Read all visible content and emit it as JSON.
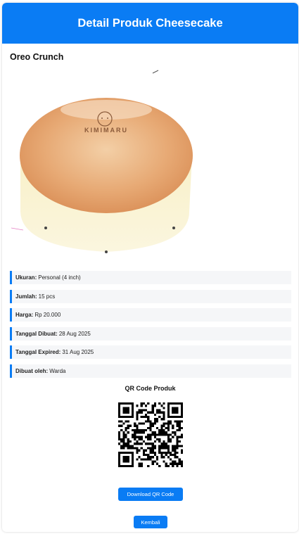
{
  "header": {
    "title": "Detail Produk Cheesecake"
  },
  "product": {
    "name": "Oreo Crunch",
    "image_icon": "cheesecake-photo",
    "image_stamp": "KIMIMARU"
  },
  "details": [
    {
      "label": "Ukuran:",
      "value": "Personal (4 inch)"
    },
    {
      "label": "Jumlah:",
      "value": "15 pcs"
    },
    {
      "label": "Harga:",
      "value": "Rp 20.000"
    },
    {
      "label": "Tanggal Dibuat:",
      "value": "28 Aug 2025"
    },
    {
      "label": "Tanggal Expired:",
      "value": "31 Aug 2025"
    },
    {
      "label": "Dibuat oleh:",
      "value": "Warda"
    }
  ],
  "qr": {
    "title": "QR Code Produk",
    "icon": "qr-code"
  },
  "buttons": {
    "download": "Download QR Code",
    "back": "Kembali"
  },
  "colors": {
    "primary": "#0a7cf4",
    "row_bg": "#f5f6f8"
  }
}
